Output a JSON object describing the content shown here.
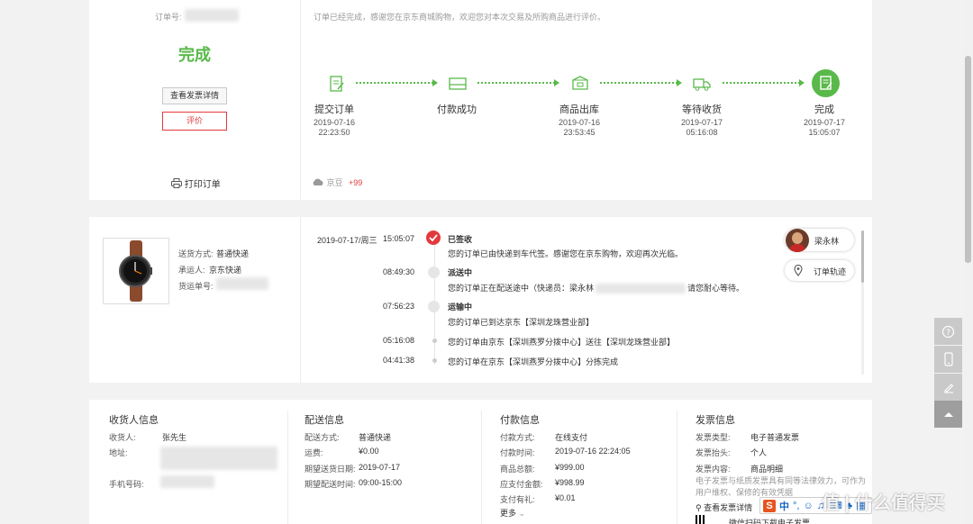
{
  "order": {
    "order_no_label": "订单号:",
    "status": "完成",
    "invoice_btn": "查看发票详情",
    "review_btn": "评价",
    "print_label": "打印订单",
    "message": "订单已经完成，感谢您在京东商城购物，欢迎您对本次交易及所购商品进行评价。",
    "jingdou_label": "京豆",
    "jingdou_value": "+99"
  },
  "progress": {
    "steps": [
      {
        "label": "提交订单",
        "date": "2019-07-16",
        "time": "22:23:50"
      },
      {
        "label": "付款成功",
        "date": "",
        "time": ""
      },
      {
        "label": "商品出库",
        "date": "2019-07-16",
        "time": "23:53:45"
      },
      {
        "label": "等待收货",
        "date": "2019-07-17",
        "time": "05:16:08"
      },
      {
        "label": "完成",
        "date": "2019-07-17",
        "time": "15:05:07"
      }
    ]
  },
  "shipment": {
    "method_label": "送货方式:",
    "method_value": "普通快递",
    "carrier_label": "承运人:",
    "carrier_value": "京东快递",
    "tracking_label": "货运单号:"
  },
  "tracking": {
    "date": "2019-07-17/周三",
    "events": [
      {
        "time": "15:05:07",
        "title": "已签收",
        "text": "您的订单已由快递到车代签。感谢您在京东购物，欢迎再次光临。"
      },
      {
        "time": "08:49:30",
        "title": "派送中",
        "text": "您的订单正在配送途中（快递员：梁永林",
        "text2": "请您耐心等待。"
      },
      {
        "time": "07:56:23",
        "title": "运输中",
        "text": "您的订单已到达京东【深圳龙珠营业部】"
      },
      {
        "time": "05:16:08",
        "title": "",
        "text": "您的订单由京东【深圳燕罗分拨中心】送往【深圳龙珠营业部】"
      },
      {
        "time": "04:41:38",
        "title": "",
        "text": "您的订单在京东【深圳燕罗分拨中心】分拣完成"
      }
    ],
    "courier_name": "梁永林",
    "track_btn": "订单轨迹"
  },
  "receiver": {
    "title": "收货人信息",
    "name_label": "收货人:",
    "name_value": "张先生",
    "addr_label": "地址:",
    "phone_label": "手机号码:"
  },
  "delivery": {
    "title": "配送信息",
    "rows": [
      {
        "label": "配送方式:",
        "value": "普通快递"
      },
      {
        "label": "运费:",
        "value": "¥0.00"
      },
      {
        "label": "期望送货日期:",
        "value": "2019-07-17"
      },
      {
        "label": "期望配送时间:",
        "value": "09:00-15:00"
      }
    ]
  },
  "payment": {
    "title": "付款信息",
    "rows": [
      {
        "label": "付款方式:",
        "value": "在线支付"
      },
      {
        "label": "付款时间:",
        "value": "2019-07-16 22:24:05"
      },
      {
        "label": "商品总额:",
        "value": "¥999.00"
      },
      {
        "label": "应支付金额:",
        "value": "¥998.99"
      },
      {
        "label": "支付有礼:",
        "value": "¥0.01"
      }
    ],
    "more": "更多"
  },
  "invoice": {
    "title": "发票信息",
    "type_label": "发票类型:",
    "type_value": "电子普通发票",
    "head_label": "发票抬头:",
    "head_value": "个人",
    "content_label": "发票内容:",
    "content_value": "商品明细",
    "note": "电子发票与纸质发票具有同等法律效力，可作为用户维权、保修的有效凭据",
    "view_link": "查看发票详情",
    "download_link": "下载",
    "qr_text": "微信扫码下载电子发票"
  },
  "ime": {
    "s_logo": "S",
    "lang": "中"
  },
  "watermark": "值 | 什么值得买",
  "colors": {
    "accent_green": "#59b94a",
    "jd_red": "#e4393c",
    "track_red": "#e4393c",
    "side_gray": "#c9c9c9"
  }
}
